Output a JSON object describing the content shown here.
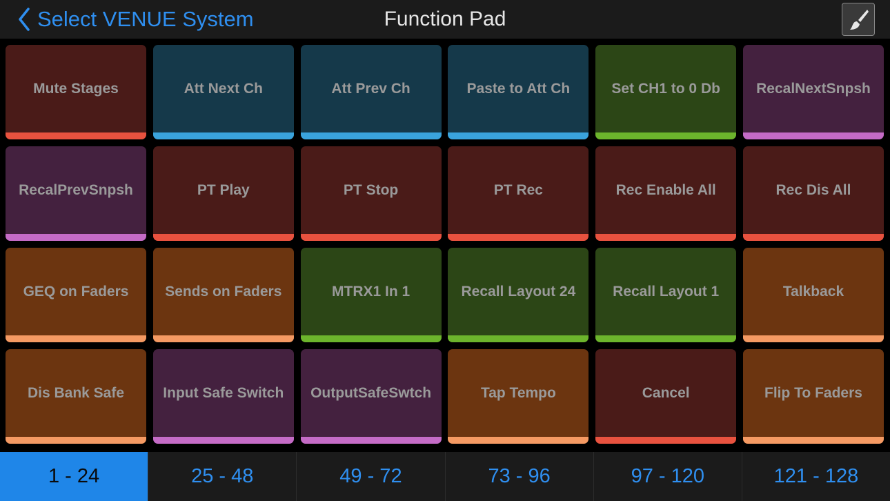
{
  "header": {
    "back_label": "Select VENUE System",
    "title": "Function Pad",
    "edit_icon": "paintbrush-icon",
    "back_icon": "chevron-left-icon"
  },
  "colors": {
    "accent": "#2f8ff0",
    "red": "#4a1b18",
    "teal": "#15394a",
    "green": "#2c4616",
    "purple": "#44213f",
    "orange": "#6c3510"
  },
  "pads": [
    {
      "label": "Mute Stages",
      "color": "red"
    },
    {
      "label": "Att Next Ch",
      "color": "teal"
    },
    {
      "label": "Att Prev Ch",
      "color": "teal"
    },
    {
      "label": "Paste to Att Ch",
      "color": "teal"
    },
    {
      "label": "Set CH1 to 0 Db",
      "color": "green"
    },
    {
      "label": "RecalNextSnpsh",
      "color": "purple"
    },
    {
      "label": "RecalPrevSnpsh",
      "color": "purple"
    },
    {
      "label": "PT Play",
      "color": "red"
    },
    {
      "label": "PT Stop",
      "color": "red"
    },
    {
      "label": "PT Rec",
      "color": "red"
    },
    {
      "label": "Rec Enable All",
      "color": "red"
    },
    {
      "label": "Rec Dis All",
      "color": "red"
    },
    {
      "label": "GEQ on Faders",
      "color": "orange"
    },
    {
      "label": "Sends on Faders",
      "color": "orange"
    },
    {
      "label": "MTRX1 In 1",
      "color": "green"
    },
    {
      "label": "Recall Layout 24",
      "color": "green"
    },
    {
      "label": "Recall Layout 1",
      "color": "green"
    },
    {
      "label": "Talkback",
      "color": "orange"
    },
    {
      "label": "Dis Bank Safe",
      "color": "orange"
    },
    {
      "label": "Input Safe Switch",
      "color": "purple"
    },
    {
      "label": "OutputSafeSwtch",
      "color": "purple"
    },
    {
      "label": "Tap Tempo",
      "color": "orange"
    },
    {
      "label": "Cancel",
      "color": "red"
    },
    {
      "label": "Flip To Faders",
      "color": "orange"
    }
  ],
  "tabs": [
    {
      "label": "1 - 24",
      "active": true
    },
    {
      "label": "25 - 48",
      "active": false
    },
    {
      "label": "49 - 72",
      "active": false
    },
    {
      "label": "73 - 96",
      "active": false
    },
    {
      "label": "97 - 120",
      "active": false
    },
    {
      "label": "121 - 128",
      "active": false
    }
  ]
}
